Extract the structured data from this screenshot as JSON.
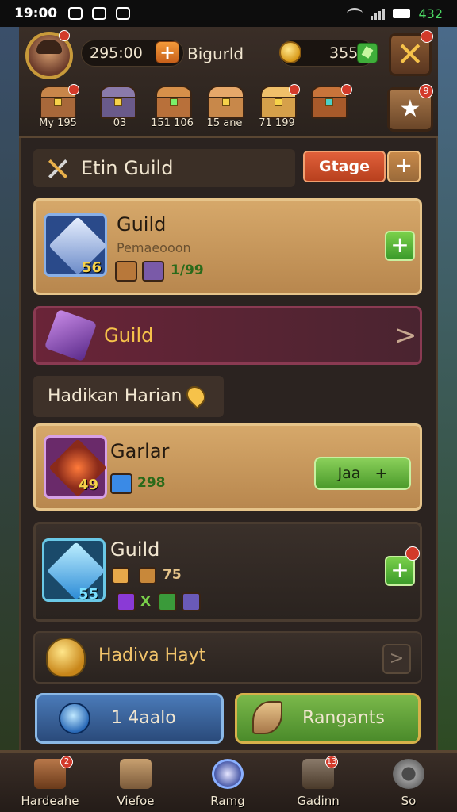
{
  "status_bar": {
    "time": "19:00",
    "battery_text": "432"
  },
  "topbar": {
    "currency_value": "295:00",
    "guild_label": "Bigurld",
    "gold_value": "355"
  },
  "chests": [
    {
      "label": "My 195"
    },
    {
      "label": "03"
    },
    {
      "label": "151 106"
    },
    {
      "label": "15 ane"
    },
    {
      "label": "71 199"
    },
    {
      "label": ""
    }
  ],
  "star_badge": "9",
  "header": {
    "title": "Etin Guild",
    "action_label": "Gtage",
    "plus_label": "+"
  },
  "cards": {
    "guild_card_1": {
      "title": "Guild",
      "subtitle": "Pemaeooon",
      "level": "56",
      "progress": "1/99",
      "add_label": "+"
    },
    "guild_banner": {
      "title": "Guild",
      "chevron": ">"
    },
    "section_title": "Hadikan Harian",
    "garlar_card": {
      "title": "Garlar",
      "level": "49",
      "value": "298",
      "join_label": "Jaa",
      "join_plus": "+"
    },
    "guild_card_2": {
      "title": "Guild",
      "level": "55",
      "count": "75",
      "multiplier": "X",
      "add_label": "+"
    },
    "daily": {
      "title": "Hadiva Hayt",
      "chevron": ">"
    }
  },
  "actions": {
    "left_button": "1 4aalo",
    "right_button": "Rangants"
  },
  "bottom_nav": [
    {
      "label": "Hardeahe",
      "badge": "2"
    },
    {
      "label": "Viefoe",
      "badge": ""
    },
    {
      "label": "Ramg",
      "badge": ""
    },
    {
      "label": "Gadinn",
      "badge": "13"
    },
    {
      "label": "So",
      "badge": ""
    }
  ],
  "colors": {
    "accent_gold": "#f6c24a",
    "button_green": "#4a9a2a",
    "button_orange": "#e0603a",
    "card_tan": "#d6a86a",
    "card_purple": "#6a2438"
  }
}
